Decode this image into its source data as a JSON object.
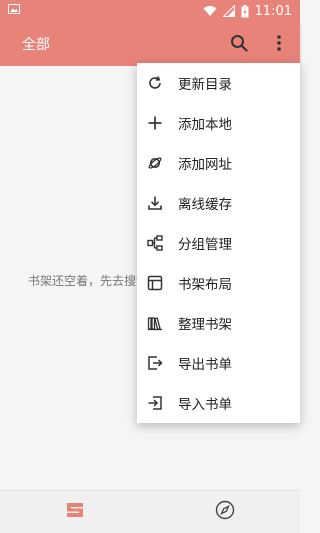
{
  "status_bar": {
    "time": "11:01"
  },
  "app_bar": {
    "title": "全部"
  },
  "content": {
    "empty_message": "书架还空着，先去搜索"
  },
  "menu": {
    "items": [
      {
        "label": "更新目录",
        "icon": "refresh-icon"
      },
      {
        "label": "添加本地",
        "icon": "add-icon"
      },
      {
        "label": "添加网址",
        "icon": "planet-icon"
      },
      {
        "label": "离线缓存",
        "icon": "download-icon"
      },
      {
        "label": "分组管理",
        "icon": "group-icon"
      },
      {
        "label": "书架布局",
        "icon": "layout-icon"
      },
      {
        "label": "整理书架",
        "icon": "books-icon"
      },
      {
        "label": "导出书单",
        "icon": "export-icon"
      },
      {
        "label": "导入书单",
        "icon": "import-icon"
      }
    ]
  },
  "colors": {
    "accent": "#e8837a",
    "menu_bg": "#ffffff",
    "page_bg": "#f5f5f5"
  }
}
